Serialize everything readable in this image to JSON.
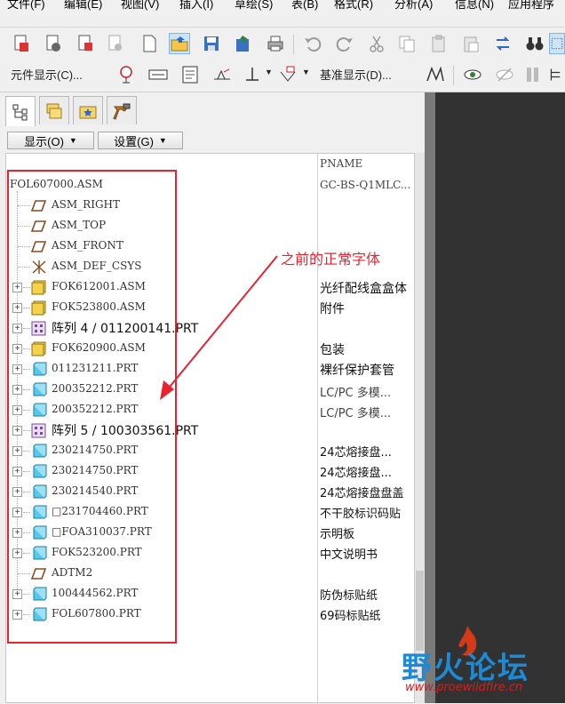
{
  "menu": [
    "文件(F)",
    "编辑(E)",
    "视图(V)",
    "插入(I)",
    "草绘(S)",
    "表(B)",
    "格式(R)",
    "分析(A)",
    "信息(N)",
    "应用程序"
  ],
  "toolbar2": {
    "component_display_label": "元件显示(C)...",
    "datum_display_label": "基准显示(D)..."
  },
  "tree_header": {
    "display_button": "显示(O)",
    "settings_button": "设置(G)"
  },
  "tree": {
    "column_header": "PNAME",
    "rows": [
      {
        "name": "FOL607000.ASM",
        "pname": "GC-BS-Q1MLC..."
      },
      {
        "name": "ASM_RIGHT",
        "pname": ""
      },
      {
        "name": "ASM_TOP",
        "pname": ""
      },
      {
        "name": "ASM_FRONT",
        "pname": ""
      },
      {
        "name": "ASM_DEF_CSYS",
        "pname": ""
      },
      {
        "name": "FOK612001.ASM",
        "pname": "光纤配线盒盒体"
      },
      {
        "name": "FOK523800.ASM",
        "pname": "附件"
      },
      {
        "name": "阵列 4 / 011200141.PRT",
        "pname": ""
      },
      {
        "name": "FOK620900.ASM",
        "pname": "包装"
      },
      {
        "name": "011231211.PRT",
        "pname": "裸纤保护套管"
      },
      {
        "name": "200352212.PRT",
        "pname": "LC/PC 多模..."
      },
      {
        "name": "200352212.PRT",
        "pname": "LC/PC 多模..."
      },
      {
        "name": "阵列 5 / 100303561.PRT",
        "pname": ""
      },
      {
        "name": "230214750.PRT",
        "pname": "24芯熔接盘..."
      },
      {
        "name": "230214750.PRT",
        "pname": "24芯熔接盘..."
      },
      {
        "name": "230214540.PRT",
        "pname": "24芯熔接盘盘盖"
      },
      {
        "name": "□231704460.PRT",
        "pname": "不干胶标识码贴"
      },
      {
        "name": "□FOA310037.PRT",
        "pname": "示明板"
      },
      {
        "name": "FOK523200.PRT",
        "pname": "中文说明书"
      },
      {
        "name": "ADTM2",
        "pname": ""
      },
      {
        "name": "100444562.PRT",
        "pname": "防伪标贴纸"
      },
      {
        "name": "FOL607800.PRT",
        "pname": "69码标贴纸"
      }
    ]
  },
  "annotation": "之前的正常字体",
  "watermark": {
    "title": "野火论坛",
    "url": "www.proewildfire.cn"
  },
  "colors": {
    "highlight": "#e8232f",
    "dark_canvas": "#323232",
    "part_icon": "#56c9ea",
    "asm_icon": "#f4d34a"
  }
}
